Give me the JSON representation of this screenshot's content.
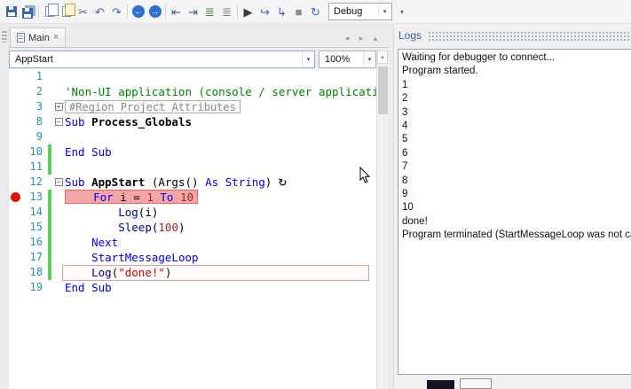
{
  "ui": {
    "dropdown_glyph": "▾",
    "scroll_up_glyph": "▲",
    "tab_scroll_left_glyph": "◂",
    "tab_scroll_right_glyph": "▸",
    "tab_list_glyph": "▴",
    "close_glyph": "×"
  },
  "toolbar": {
    "mode_value": "Debug",
    "overflow_glyph": "▾",
    "buttons": [
      {
        "name": "save",
        "icon": "floppy-icon",
        "type": "floppy"
      },
      {
        "name": "save-all",
        "icon": "floppy-stack-icon",
        "type": "floppy2"
      },
      {
        "type": "sep"
      },
      {
        "name": "copy",
        "icon": "copy-docs-icon",
        "type": "docs"
      },
      {
        "name": "paste",
        "icon": "paste-icon",
        "type": "docs2"
      },
      {
        "name": "cut",
        "icon": "scissors-icon",
        "type": "glyph",
        "glyph": "✂",
        "color": "#5a6b7d"
      },
      {
        "name": "undo",
        "icon": "undo-arrow-icon",
        "type": "glyph",
        "glyph": "↶",
        "color": "#4a5fc1"
      },
      {
        "name": "redo",
        "icon": "redo-arrow-icon",
        "type": "glyph",
        "glyph": "↷",
        "color": "#4a5fc1"
      },
      {
        "type": "sep"
      },
      {
        "name": "navigate-back",
        "icon": "back-circle-icon",
        "type": "circle",
        "glyph": "←"
      },
      {
        "name": "navigate-forward",
        "icon": "forward-circle-icon",
        "type": "circle",
        "glyph": "→"
      },
      {
        "type": "sep"
      },
      {
        "name": "outdent",
        "icon": "outdent-icon",
        "type": "glyph",
        "glyph": "⇤",
        "color": "#44617e"
      },
      {
        "name": "indent",
        "icon": "indent-icon",
        "type": "glyph",
        "glyph": "⇥",
        "color": "#44617e"
      },
      {
        "name": "comment",
        "icon": "comment-lines-icon",
        "type": "glyph",
        "glyph": "≣",
        "color": "#3f7f3f"
      },
      {
        "name": "uncomment",
        "icon": "uncomment-lines-icon",
        "type": "glyph",
        "glyph": "≣",
        "color": "#7d7d7d"
      },
      {
        "type": "sep"
      },
      {
        "name": "run",
        "icon": "play-icon",
        "type": "glyph",
        "glyph": "▶",
        "color": "#3c3c3c"
      },
      {
        "name": "step-over",
        "icon": "step-over-icon",
        "type": "glyph",
        "glyph": "↪",
        "color": "#4a5fc1"
      },
      {
        "name": "step-into",
        "icon": "step-into-icon",
        "type": "glyph",
        "glyph": "↳",
        "color": "#4a5fc1"
      },
      {
        "name": "stop",
        "icon": "stop-icon",
        "type": "glyph",
        "glyph": "■",
        "color": "#8a8a8a"
      },
      {
        "name": "restart",
        "icon": "restart-icon",
        "type": "glyph",
        "glyph": "↻",
        "color": "#2f6fd0"
      }
    ]
  },
  "tabbar": {
    "tabs": [
      {
        "label": "Main"
      }
    ]
  },
  "editor": {
    "member_selector": "AppStart",
    "zoom_selector": "100%",
    "lines": [
      {
        "num": "1",
        "tokens": []
      },
      {
        "num": "2",
        "tokens": [
          {
            "t": "'Non-UI application (console / server application)",
            "c": "comment"
          }
        ]
      },
      {
        "num": "3",
        "fold": "+",
        "region": "#Region Project Attributes",
        "tokens": []
      },
      {
        "num": "8",
        "fold": "-",
        "tokens": [
          {
            "t": "Sub ",
            "c": "kw"
          },
          {
            "t": "Process_Globals",
            "c": "def"
          }
        ]
      },
      {
        "num": "9",
        "tokens": []
      },
      {
        "num": "10",
        "changed": true,
        "tokens": [
          {
            "t": "End Sub",
            "c": "kw"
          }
        ]
      },
      {
        "num": "11",
        "changed": true,
        "tokens": []
      },
      {
        "num": "12",
        "fold": "-",
        "trail": "↻",
        "tokens": [
          {
            "t": "Sub ",
            "c": "kw"
          },
          {
            "t": "AppStart ",
            "c": "def"
          },
          {
            "t": "(Args() ",
            "c": "plain"
          },
          {
            "t": "As ",
            "c": "kw"
          },
          {
            "t": "String",
            "c": "kw"
          },
          {
            "t": ")",
            "c": "plain"
          }
        ]
      },
      {
        "num": "13",
        "breakpoint": true,
        "changed": true,
        "highlight": true,
        "indent": 1,
        "tokens": [
          {
            "t": "For ",
            "c": "kw"
          },
          {
            "t": "i = ",
            "c": "plain"
          },
          {
            "t": "1",
            "c": "numlit"
          },
          {
            "t": " ",
            "c": "plain"
          },
          {
            "t": "To ",
            "c": "kw"
          },
          {
            "t": "10",
            "c": "numlit"
          }
        ]
      },
      {
        "num": "14",
        "changed": true,
        "indent": 2,
        "tokens": [
          {
            "t": "Log",
            "c": "member"
          },
          {
            "t": "(i)",
            "c": "plain"
          }
        ]
      },
      {
        "num": "15",
        "changed": true,
        "indent": 2,
        "tokens": [
          {
            "t": "Sleep",
            "c": "member"
          },
          {
            "t": "(",
            "c": "plain"
          },
          {
            "t": "100",
            "c": "numlit"
          },
          {
            "t": ")",
            "c": "plain"
          }
        ]
      },
      {
        "num": "16",
        "changed": true,
        "indent": 1,
        "tokens": [
          {
            "t": "Next",
            "c": "kw"
          }
        ]
      },
      {
        "num": "17",
        "changed": true,
        "indent": 1,
        "tokens": [
          {
            "t": "StartMessageLoop",
            "c": "kw"
          }
        ]
      },
      {
        "num": "18",
        "changed": true,
        "outline": true,
        "indent": 1,
        "tokens": [
          {
            "t": "Log",
            "c": "member"
          },
          {
            "t": "(",
            "c": "plain"
          },
          {
            "t": "\"done!\"",
            "c": "str"
          },
          {
            "t": ")",
            "c": "plain"
          }
        ]
      },
      {
        "num": "19",
        "tokens": [
          {
            "t": "End Sub",
            "c": "kw"
          }
        ]
      }
    ]
  },
  "logs": {
    "title": "Logs",
    "lines": [
      "Waiting for debugger to connect...",
      "Program started.",
      "1",
      "2",
      "3",
      "4",
      "5",
      "6",
      "7",
      "8",
      "9",
      "10",
      "done!",
      "Program terminated (StartMessageLoop was not called)"
    ]
  },
  "colors": {
    "accent_blue": "#2f6fd0",
    "breakpoint_red": "#e01400",
    "changed_line_green": "#5ad05a",
    "breakpoint_highlight": "#f4a6a6",
    "keyword_blue": "#0000e8",
    "comment_green": "#008000",
    "string_red": "#c80000",
    "line_number_blue": "#2b91af"
  }
}
